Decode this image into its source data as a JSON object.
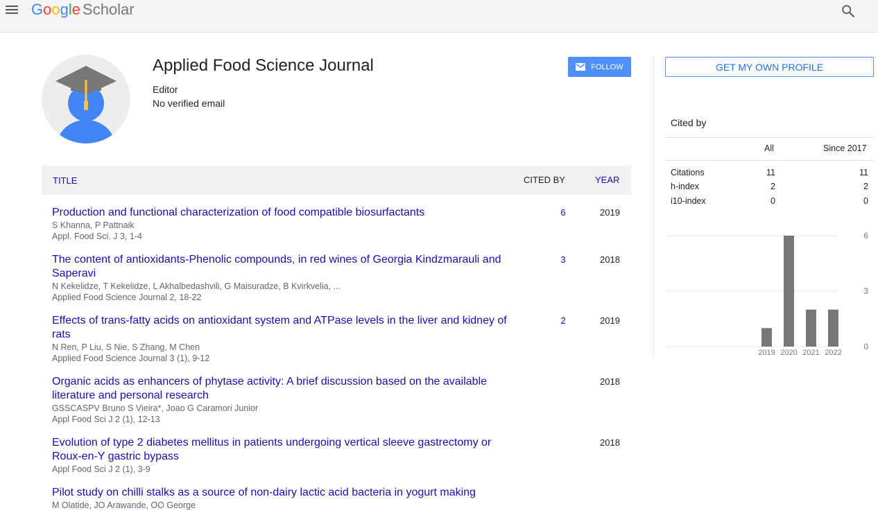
{
  "header": {
    "logo_google": [
      "G",
      "o",
      "o",
      "g",
      "l",
      "e"
    ],
    "logo_scholar": "Scholar"
  },
  "profile": {
    "name": "Applied Food Science Journal",
    "affiliation": "Editor",
    "email": "No verified email",
    "follow_label": "FOLLOW"
  },
  "table": {
    "col_title": "TITLE",
    "col_cited": "CITED BY",
    "col_year": "YEAR",
    "rows": [
      {
        "title": "Production and functional characterization of food compatible biosurfactants",
        "authors": "S Khanna, P Pattnaik",
        "venue": "Appl. Food Sci. J 3, 1-4",
        "cites": "6",
        "year": "2019"
      },
      {
        "title": "The content of antioxidants-Phenolic compounds, in red wines of Georgia Kindzmarauli and Saperavi",
        "authors": "N Kekelidze, T Kekelidze, L Akhalbedashvili, G Maisuradze, B Kvirkvelia, ...",
        "venue": "Applied Food Science Journal 2, 18-22",
        "cites": "3",
        "year": "2018"
      },
      {
        "title": "Effects of trans-fatty acids on antioxidant system and ATPase levels in the liver and kidney of rats",
        "authors": "N Ren, P Liu, S Nie, S Zhang, M Chen",
        "venue": "Applied Food Science Journal 3 (1), 9-12",
        "cites": "2",
        "year": "2019"
      },
      {
        "title": "Organic acids as enhancers of phytase activity: A brief discussion based on the available literature and personal research",
        "authors": "GSSCASPV Bruno S Vieira*, Joao G Caramori Junior",
        "venue": "Appl Food Sci J 2 (1), 12-13",
        "cites": "",
        "year": "2018"
      },
      {
        "title": "Evolution of type 2 diabetes mellitus in patients undergoing vertical sleeve gastrectomy or Roux-en-Y gastric bypass",
        "authors": "",
        "venue": "Appl Food Sci J 2 (1), 3-9",
        "cites": "",
        "year": "2018"
      },
      {
        "title": "Pilot study on chilli stalks as a source of non-dairy lactic acid bacteria in yogurt making",
        "authors": "M Olatide, JO Arawande, OO George",
        "venue": "",
        "cites": "",
        "year": ""
      }
    ]
  },
  "sidebar": {
    "own_profile_label": "GET MY OWN PROFILE",
    "cited_by_label": "Cited by",
    "col_all": "All",
    "col_since": "Since 2017",
    "stats": [
      {
        "label": "Citations",
        "all": "11",
        "since": "11"
      },
      {
        "label": "h-index",
        "all": "2",
        "since": "2"
      },
      {
        "label": "i10-index",
        "all": "0",
        "since": "0"
      }
    ]
  },
  "chart_data": {
    "type": "bar",
    "categories": [
      "2019",
      "2020",
      "2021",
      "2022"
    ],
    "values": [
      1,
      6,
      2,
      2
    ],
    "yticks": [
      0,
      3,
      6
    ],
    "ylim": [
      0,
      6
    ],
    "bar_color": "#777777",
    "grid": true
  },
  "colors": {
    "link": "#1a0dab",
    "accent": "#4d90fe",
    "bar": "#777777"
  }
}
